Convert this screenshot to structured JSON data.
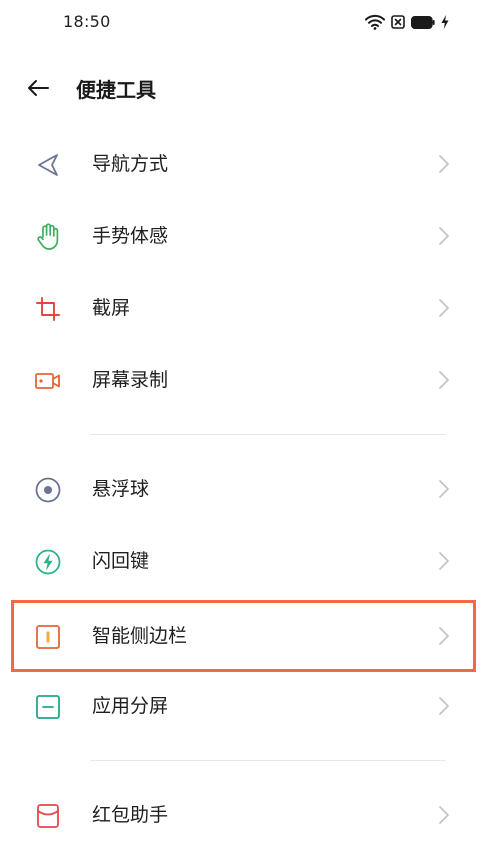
{
  "status_bar": {
    "time": "18:50",
    "icons": [
      "wifi-icon",
      "sim-off-icon",
      "battery-icon",
      "charging-icon"
    ]
  },
  "header": {
    "title": "便捷工具",
    "back_icon": "arrow-left-icon"
  },
  "items": [
    {
      "label": "导航方式",
      "icon": "navigation-triangle-icon",
      "color": "#6b7493"
    },
    {
      "label": "手势体感",
      "icon": "hand-gesture-icon",
      "color": "#3cae62"
    },
    {
      "label": "截屏",
      "icon": "crop-icon",
      "color": "#e2463d"
    },
    {
      "label": "屏幕录制",
      "icon": "video-record-icon",
      "color": "#e2663a"
    },
    {
      "label": "悬浮球",
      "icon": "floating-ball-icon",
      "color": "#6b7493"
    },
    {
      "label": "闪回键",
      "icon": "flashback-icon",
      "color": "#2bb48a"
    },
    {
      "label": "智能侧边栏",
      "icon": "sidebar-icon",
      "color": "#e2663a"
    },
    {
      "label": "应用分屏",
      "icon": "split-screen-icon",
      "color": "#23a58e"
    },
    {
      "label": "红包助手",
      "icon": "red-envelope-icon",
      "color": "#e5484d"
    }
  ],
  "chevron_icon": "chevron-right-icon",
  "highlight_color": "#f26a43",
  "chevron_color": "#c4c4c4"
}
